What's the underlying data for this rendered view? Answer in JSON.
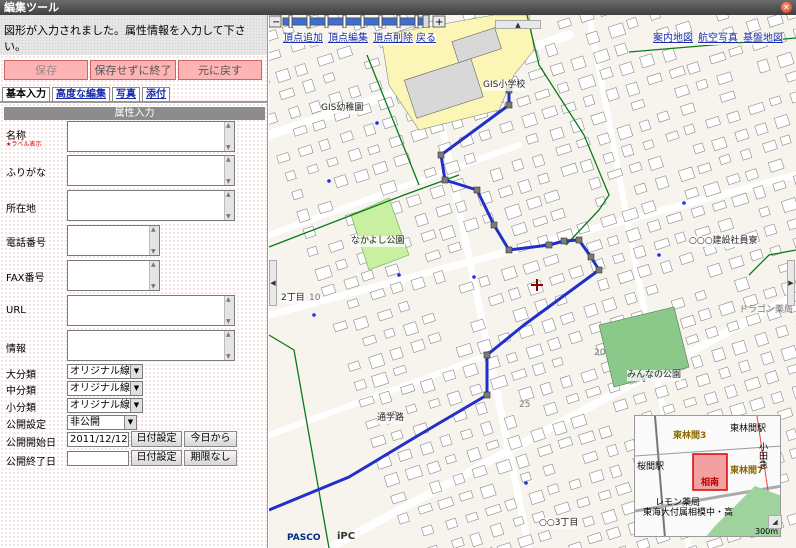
{
  "window": {
    "title": "編集ツール"
  },
  "message": "図形が入力されました。属性情報を入力して下さい。",
  "buttons": {
    "save": "保存",
    "exit_nosave": "保存せずに終了",
    "revert": "元に戻す"
  },
  "tabs": [
    {
      "label": "基本入力",
      "active": true
    },
    {
      "label": "高度な編集",
      "active": false
    },
    {
      "label": "写真",
      "active": false
    },
    {
      "label": "添付",
      "active": false
    }
  ],
  "section_title": "属性入力",
  "fields": {
    "name": {
      "label": "名称",
      "sub": "★ラベル表示"
    },
    "kana": {
      "label": "ふりがな"
    },
    "address": {
      "label": "所在地"
    },
    "phone": {
      "label": "電話番号"
    },
    "fax": {
      "label": "FAX番号"
    },
    "url": {
      "label": "URL"
    },
    "info": {
      "label": "情報"
    },
    "major": {
      "label": "大分類",
      "value": "オリジナル線"
    },
    "middle": {
      "label": "中分類",
      "value": "オリジナル線"
    },
    "minor": {
      "label": "小分類",
      "value": "オリジナル線"
    },
    "publish": {
      "label": "公開設定",
      "value": "非公開"
    },
    "start": {
      "label": "公開開始日",
      "value": "2011/12/12",
      "set_btn": "日付設定",
      "today_btn": "今日から"
    },
    "end": {
      "label": "公開終了日",
      "value": "",
      "set_btn": "日付設定",
      "nolimit_btn": "期限なし"
    }
  },
  "map": {
    "links_left": [
      "頂点追加",
      "頂点編集",
      "頂点削除",
      "戻る"
    ],
    "links_right": [
      "案内地図",
      "航空写真",
      "基盤地図"
    ],
    "labels": {
      "school": "GIS小学校",
      "kindergarten": "GIS幼稚園",
      "park1": "なかよし公園",
      "dorm": "○○○建設社員寮",
      "chome": "2丁目",
      "park2": "みんなの公園",
      "road": "通学路",
      "chome3": "○○3丁目",
      "small1": "10",
      "small2": "20",
      "small3": "25",
      "dragon": "ドラゴン薬局"
    },
    "inset": {
      "labels": [
        "東林間3",
        "東林間駅",
        "東林間7",
        "相南",
        "小田急",
        "桜間駅",
        "レモン薬局",
        "東海大付属相模中・高"
      ],
      "scale": "300m"
    },
    "logos": [
      "PASCO",
      "iPC"
    ],
    "accent_route": "#2030c8",
    "vertex_color": "#7a7a7a"
  }
}
